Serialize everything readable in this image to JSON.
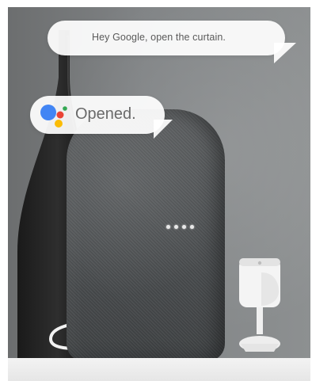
{
  "conversation": {
    "user_message": "Hey Google, open the curtain.",
    "assistant_reply": "Opened."
  },
  "assistant_icon": {
    "name": "google-assistant-icon",
    "colors": [
      "#4285F4",
      "#EA4335",
      "#FBBC05",
      "#34A853"
    ]
  },
  "speaker": {
    "led_color": "#e8e8e8",
    "fabric_color": "#4b4e50"
  }
}
